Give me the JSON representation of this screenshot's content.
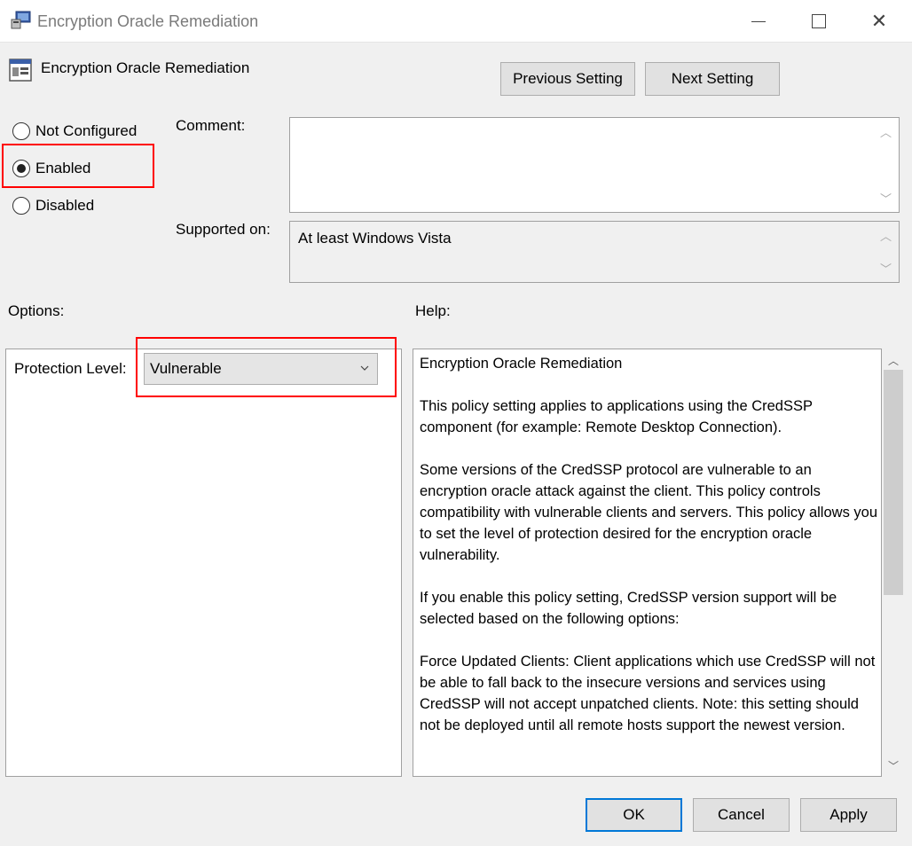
{
  "window": {
    "title": "Encryption Oracle Remediation",
    "controls": {
      "minimize": "minimize-icon",
      "maximize": "maximize-icon",
      "close": "✕"
    }
  },
  "policy": {
    "name": "Encryption Oracle Remediation"
  },
  "nav": {
    "previous": "Previous Setting",
    "next": "Next Setting"
  },
  "state": {
    "options": [
      {
        "label": "Not Configured",
        "checked": false
      },
      {
        "label": "Enabled",
        "checked": true
      },
      {
        "label": "Disabled",
        "checked": false
      }
    ]
  },
  "comment": {
    "label": "Comment:",
    "value": ""
  },
  "supported": {
    "label": "Supported on:",
    "value": "At least Windows Vista"
  },
  "options_section": {
    "label": "Options:",
    "protection_label": "Protection Level:",
    "protection_value": "Vulnerable"
  },
  "help": {
    "label": "Help:",
    "paragraphs": [
      "Encryption Oracle Remediation",
      "This policy setting applies to applications using the CredSSP component (for example: Remote Desktop Connection).",
      "Some versions of the CredSSP protocol are vulnerable to an encryption oracle attack against the client.  This policy controls compatibility with vulnerable clients and servers.  This policy allows you to set the level of protection desired for the encryption oracle vulnerability.",
      "If you enable this policy setting, CredSSP version support will be selected based on the following options:",
      "Force Updated Clients: Client applications which use CredSSP will not be able to fall back to the insecure versions and services using CredSSP will not accept unpatched clients. Note: this setting should not be deployed until all remote hosts support the newest version."
    ]
  },
  "footer": {
    "ok": "OK",
    "cancel": "Cancel",
    "apply": "Apply"
  },
  "colors": {
    "highlight": "#ff0000",
    "focus": "#0078d7"
  }
}
